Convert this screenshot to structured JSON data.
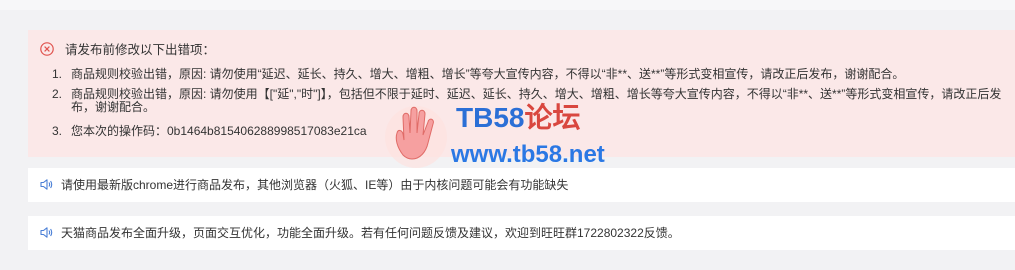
{
  "error": {
    "title": "请发布前修改以下出错项：",
    "items": [
      {
        "num": "1.",
        "text": "商品规则校验出错，原因: 请勿使用“延迟、延长、持久、增大、增粗、增长”等夸大宣传内容，不得以“非**、送**”等形式变相宣传，请改正后发布，谢谢配合。"
      },
      {
        "num": "2.",
        "text": "商品规则校验出错，原因: 请勿使用【[\"延\",\"时\"]】，包括但不限于延时、延迟、延长、持久、增大、增粗、增长等夸大宣传内容，不得以“非**、送**”等形式变相宣传，请改正后发布，谢谢配合。"
      },
      {
        "num": "3.",
        "text": "您本次的操作码：0b1464b815406288998517083e21ca"
      }
    ]
  },
  "notices": [
    {
      "text": "请使用最新版chrome进行商品发布，其他浏览器（火狐、IE等）由于内核问题可能会有功能缺失"
    },
    {
      "text": "天猫商品发布全面升级，页面交互优化，功能全面升级。若有任何问题反馈及建议，欢迎到旺旺群1722802322反馈。"
    }
  ],
  "watermark": {
    "title_a": "TB58",
    "title_b": "论坛",
    "url": "www.tb58.net"
  },
  "colors": {
    "error_bg": "#fbe8e8",
    "error_icon": "#e0534e",
    "notice_icon": "#4a7fd6",
    "watermark_blue": "#2b78e4",
    "watermark_red": "#d9473f"
  }
}
